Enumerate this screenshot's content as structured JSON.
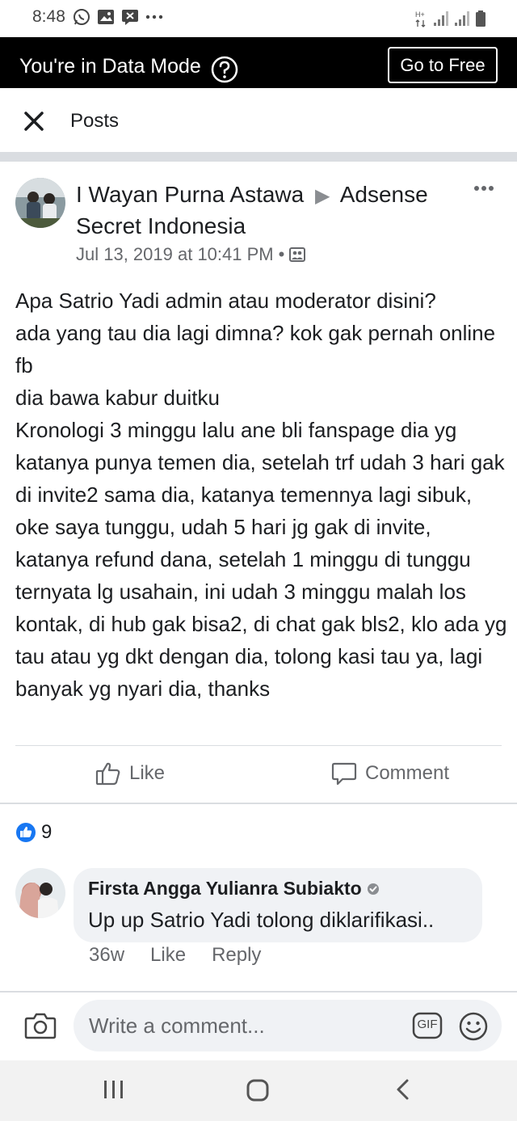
{
  "status_bar": {
    "time": "8:48",
    "left_icons": [
      "whatsapp-icon",
      "image-icon",
      "message-icon",
      "more-notifications-icon"
    ],
    "right_icons": [
      "hspa-icon",
      "signal-icon",
      "signal-icon-2",
      "battery-icon"
    ]
  },
  "data_mode": {
    "text": "You're in Data Mode",
    "button_label": "Go to Free"
  },
  "header": {
    "title": "Posts"
  },
  "post": {
    "author": "I Wayan Purna Astawa",
    "group": "Adsense Secret Indonesia",
    "timestamp": "Jul 13, 2019 at 10:41 PM",
    "separator": "•",
    "privacy_icon": "group-members-icon",
    "body": "Apa Satrio Yadi admin atau moderator disini?\nada yang tau dia lagi dimna? kok gak pernah online fb\ndia bawa kabur duitku\nKronologi 3 minggu lalu ane bli fanspage dia yg katanya punya temen dia, setelah trf udah 3 hari gak di invite2 sama dia, katanya temennya lagi sibuk, oke saya tunggu, udah 5 hari jg gak di invite, katanya refund dana, setelah 1 minggu di tunggu ternyata lg usahain, ini udah 3 minggu malah los kontak, di hub gak bisa2, di chat gak bls2, klo ada yg tau atau yg dkt dengan dia, tolong kasi tau ya, lagi banyak yg nyari dia, thanks",
    "actions": {
      "like_label": "Like",
      "comment_label": "Comment"
    },
    "reactions_count": "9"
  },
  "comments": [
    {
      "author": "Firsta Angga Yulianra Subiakto",
      "text": "Up up Satrio Yadi tolong diklarifikasi..",
      "age": "36w",
      "like_label": "Like",
      "reply_label": "Reply"
    }
  ],
  "composer": {
    "placeholder": "Write a comment...",
    "gif_label": "GIF"
  },
  "colors": {
    "brand_blue": "#1877f2",
    "data_mode_bar": "#000000",
    "secondary_text": "#65676b"
  }
}
